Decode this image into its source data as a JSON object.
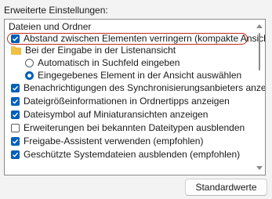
{
  "section_label": "Erweiterte Einstellungen:",
  "tree": {
    "root_label": "Dateien und Ordner",
    "items": [
      {
        "label": "Abstand zwischen Elementen verringern (kompakte Ansicht)",
        "checked": true
      },
      {
        "label": "Bei der Eingabe in der Listenansicht"
      },
      {
        "label": "Automatisch in Suchfeld eingeben",
        "selected": false
      },
      {
        "label": "Eingegebenes Element in der Ansicht auswählen",
        "selected": true
      },
      {
        "label": "Benachrichtigungen des Synchronisierungsanbieters anzeigen",
        "checked": true
      },
      {
        "label": "Dateigrößeinformationen in Ordnertipps anzeigen",
        "checked": true
      },
      {
        "label": "Dateisymbol auf Miniaturansichten anzeigen",
        "checked": true
      },
      {
        "label": "Erweiterungen bei bekannten Dateitypen ausblenden",
        "checked": false
      },
      {
        "label": "Freigabe-Assistent verwenden (empfohlen)",
        "checked": true
      },
      {
        "label": "Geschützte Systemdateien ausblenden (empfohlen)",
        "checked": true
      }
    ]
  },
  "buttons": {
    "defaults_label": "Standardwerte"
  },
  "colors": {
    "accent": "#005fb8",
    "highlight_ring": "#c42b1c",
    "folder": "#f3c140"
  }
}
